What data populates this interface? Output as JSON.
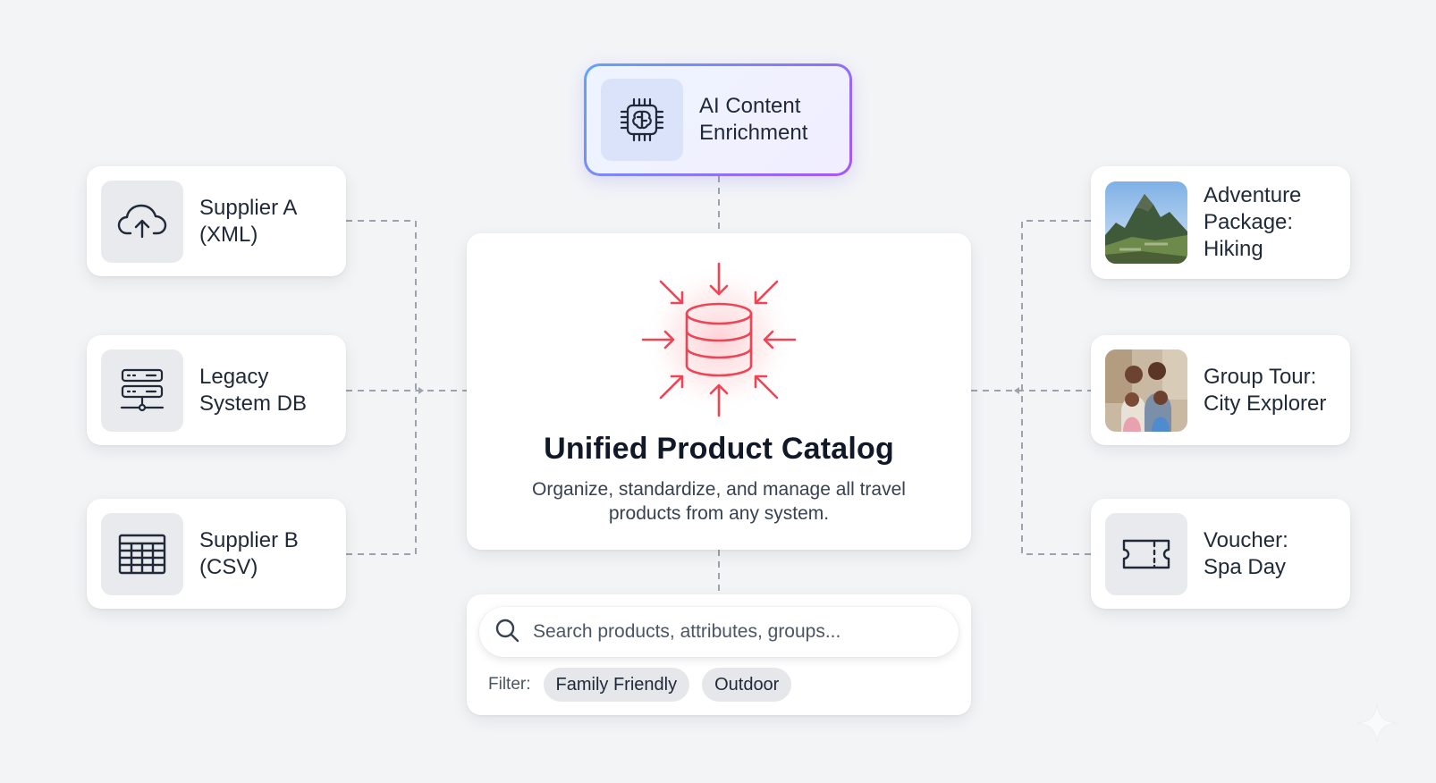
{
  "ai_enrichment": {
    "label": "AI Content\nEnrichment",
    "icon": "ai-chip-brain-icon"
  },
  "sources": [
    {
      "label": "Supplier A\n(XML)",
      "icon": "cloud-upload-icon"
    },
    {
      "label": "Legacy\nSystem DB",
      "icon": "server-icon"
    },
    {
      "label": "Supplier B\n(CSV)",
      "icon": "table-grid-icon"
    }
  ],
  "outputs": [
    {
      "label": "Adventure\nPackage:\nHiking",
      "icon": "mountain-photo"
    },
    {
      "label": "Group Tour:\nCity Explorer",
      "icon": "family-photo"
    },
    {
      "label": "Voucher:\nSpa Day",
      "icon": "ticket-icon"
    }
  ],
  "catalog": {
    "title": "Unified Product Catalog",
    "description": "Organize, standardize, and manage all travel products from any system.",
    "icon": "database-converge-icon",
    "accent_color": "#ef4455"
  },
  "search": {
    "placeholder": "Search products, attributes, groups...",
    "filter_label": "Filter:",
    "filters": [
      "Family Friendly",
      "Outdoor"
    ]
  },
  "colors": {
    "background": "#f3f4f6",
    "connector": "#9ca3af",
    "ai_border_start": "#60a5fa",
    "ai_border_end": "#a855f7"
  }
}
